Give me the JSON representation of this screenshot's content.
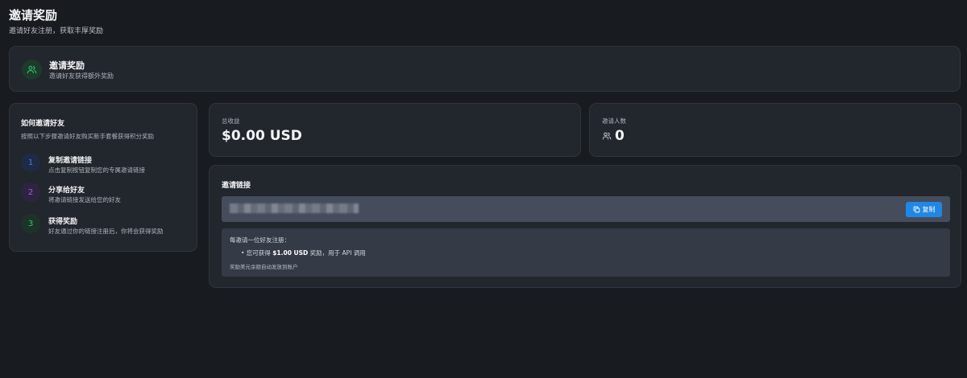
{
  "page": {
    "title": "邀请奖励",
    "subtitle": "邀请好友注册，获取丰厚奖励"
  },
  "hero": {
    "icon": "users-icon",
    "title": "邀请奖励",
    "subtitle": "邀请好友获得额外奖励",
    "accent": "#34c26b"
  },
  "howto": {
    "title": "如何邀请好友",
    "description": "按照以下步骤邀请好友购买新手套餐获得积分奖励",
    "steps": [
      {
        "number": "1",
        "title": "复制邀请链接",
        "desc": "点击复制按钮复制您的专属邀请链接",
        "color": "#4a78ea",
        "bg": "#1f2a44"
      },
      {
        "number": "2",
        "title": "分享给好友",
        "desc": "将邀请链接发送给您的好友",
        "color": "#a35de6",
        "bg": "#2e2440"
      },
      {
        "number": "3",
        "title": "获得奖励",
        "desc": "好友通过你的链接注册后，你将会获得奖励",
        "color": "#34c26b",
        "bg": "#1e3328"
      }
    ]
  },
  "stats": {
    "earnings_label": "总收益",
    "earnings_value": "$0.00 USD",
    "invites_label": "邀请人数",
    "invites_icon": "users-icon",
    "invites_value": "0"
  },
  "invite_link": {
    "title": "邀请链接",
    "url": "",
    "copy_label": "复制",
    "copy_icon": "copy-icon",
    "button_color": "#2187e4",
    "info_head": "每邀请一位好友注册：",
    "bullet_prefix": "• 您可获得",
    "bullet_amount": "$1.00 USD",
    "bullet_suffix": "奖励，用于 API 调用",
    "info_foot": "奖励美元余额自动发放到账户"
  }
}
